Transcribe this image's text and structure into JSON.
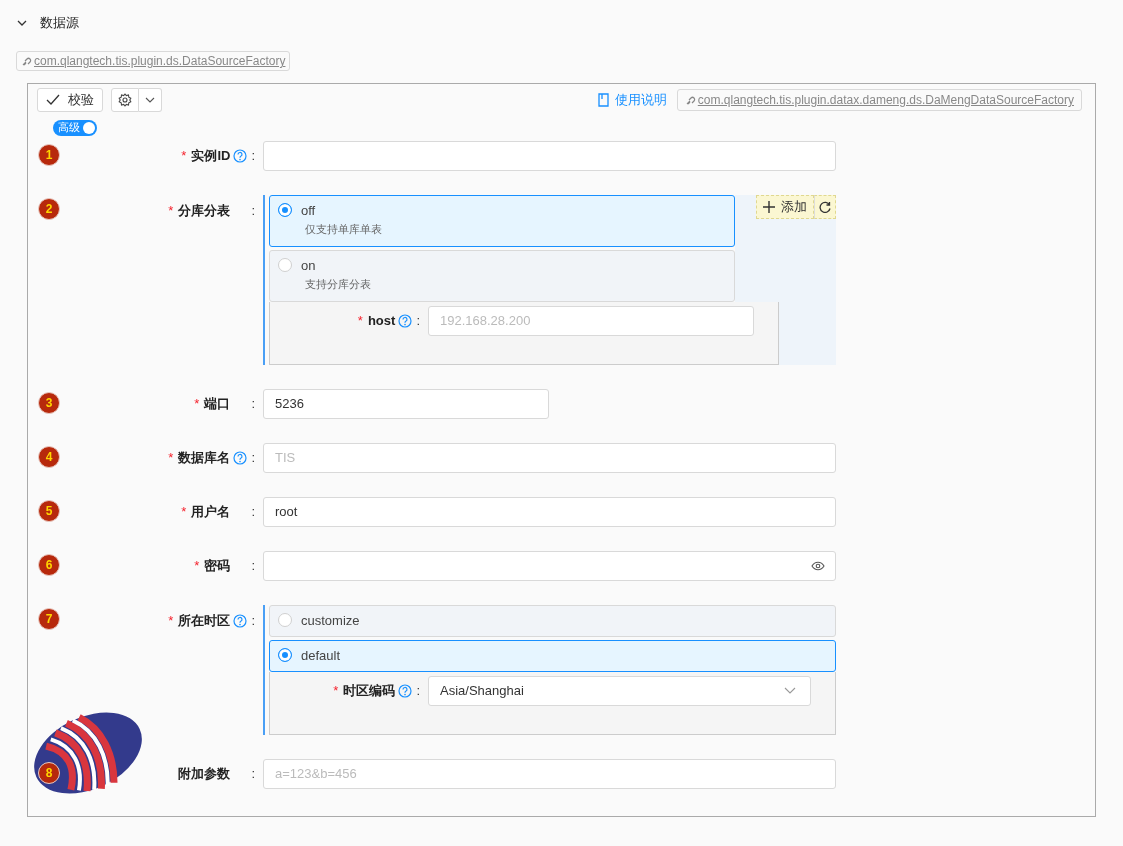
{
  "section": {
    "title": "数据源",
    "expanded": true
  },
  "plugin_tag": "com.qlangtech.tis.plugin.ds.DataSourceFactory",
  "toolbar": {
    "validate_button": "校验",
    "advanced_toggle": {
      "label": "高级",
      "on": true
    },
    "help_link": "使用说明",
    "impl_tag": "com.qlangtech.tis.plugin.datax.dameng.ds.DaMengDataSourceFactory"
  },
  "fields": [
    {
      "kind": "text",
      "badge": "1",
      "required_mark": "*",
      "label": "实例ID",
      "help": true,
      "colon": ":"
    },
    {
      "kind": "options",
      "badge": "2",
      "required_mark": "*",
      "label": "分库分表",
      "help": false,
      "colon": ":",
      "add_button": "添加",
      "options": [
        {
          "label": "off",
          "description": "仅支持单库单表",
          "selected": true
        },
        {
          "label": "on",
          "description": "支持分库分表",
          "selected": false
        }
      ],
      "subfields": [
        {
          "kind": "text",
          "required_mark": "*",
          "label": "host",
          "help": true,
          "colon": ":",
          "placeholder": "192.168.28.200"
        }
      ]
    },
    {
      "kind": "number",
      "badge": "3",
      "required_mark": "*",
      "label": "端口",
      "help": false,
      "colon": ":",
      "value": "5236"
    },
    {
      "kind": "text",
      "badge": "4",
      "required_mark": "*",
      "label": "数据库名",
      "help": true,
      "colon": ":",
      "placeholder": "TIS"
    },
    {
      "kind": "text",
      "badge": "5",
      "required_mark": "*",
      "label": "用户名",
      "help": false,
      "colon": ":",
      "value": "root"
    },
    {
      "kind": "password",
      "badge": "6",
      "required_mark": "*",
      "label": "密码",
      "help": false,
      "colon": ":"
    },
    {
      "kind": "options",
      "badge": "7",
      "required_mark": "*",
      "label": "所在时区",
      "help": true,
      "colon": ":",
      "options": [
        {
          "label": "customize",
          "selected": false
        },
        {
          "label": "default",
          "selected": true
        }
      ],
      "subfields": [
        {
          "kind": "select",
          "required_mark": "*",
          "label": "时区编码",
          "help": true,
          "colon": ":",
          "value": "Asia/Shanghai"
        }
      ]
    },
    {
      "kind": "text",
      "badge": "8",
      "label": "附加参数",
      "help": false,
      "colon": ":",
      "placeholder": "a=123&b=456"
    }
  ]
}
